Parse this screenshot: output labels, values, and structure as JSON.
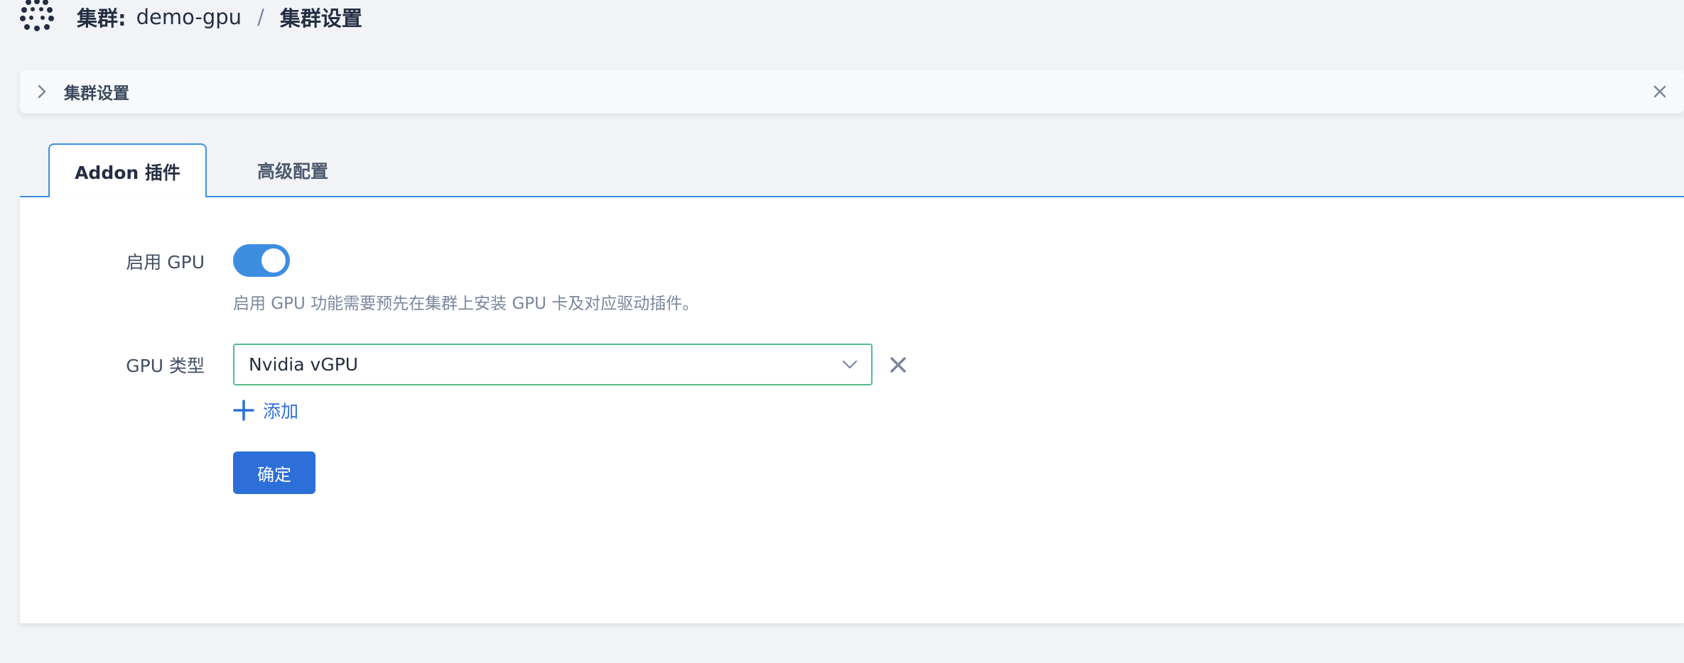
{
  "breadcrumb": {
    "cluster_label": "集群:",
    "cluster_name": "demo-gpu",
    "separator": "/",
    "current": "集群设置",
    "logo_icon": "cluster-logo-icon"
  },
  "info_bar": {
    "title": "集群设置",
    "expand_icon": "chevron-right-icon",
    "close_icon": "close-icon"
  },
  "tabs": [
    {
      "label": "Addon 插件",
      "active": true
    },
    {
      "label": "高级配置",
      "active": false
    }
  ],
  "form": {
    "gpu_enable": {
      "label": "启用 GPU",
      "enabled": true,
      "hint": "启用 GPU 功能需要预先在集群上安装 GPU 卡及对应驱动插件。"
    },
    "gpu_type": {
      "label": "GPU 类型",
      "selected": "Nvidia vGPU"
    },
    "add_label": "添加",
    "confirm_label": "确定"
  },
  "colors": {
    "accent": "#3d8ee0",
    "primary_button": "#2d6fd8",
    "select_border": "#55bc8a",
    "background": "#f1f3f7"
  }
}
